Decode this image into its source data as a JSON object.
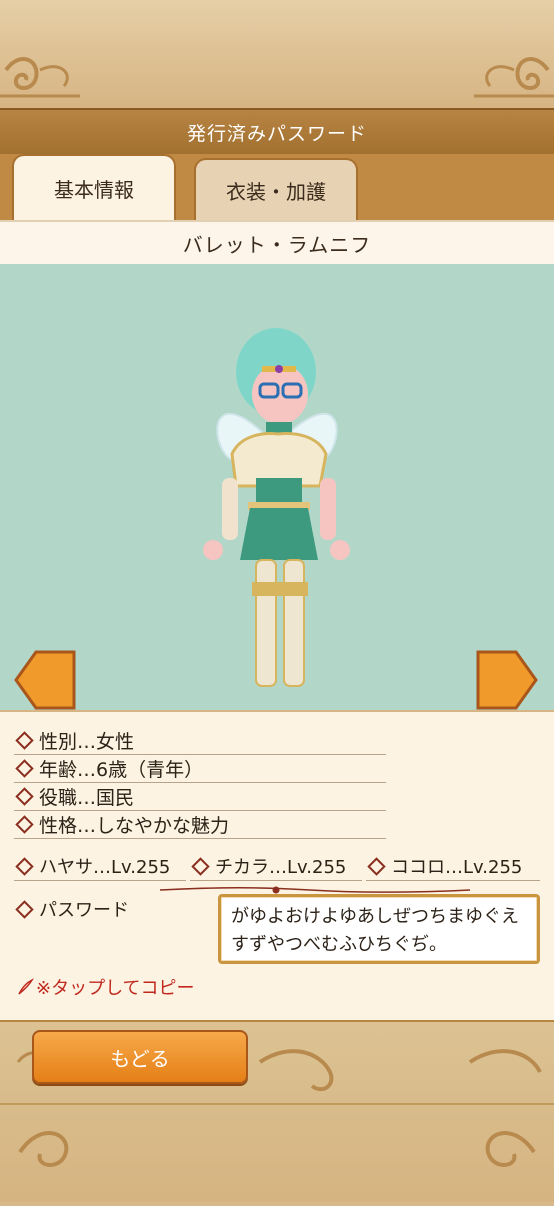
{
  "header": {
    "title": "発行済みパスワード"
  },
  "tabs": [
    {
      "label": "基本情報",
      "active": true
    },
    {
      "label": "衣装・加護",
      "active": false
    }
  ],
  "character": {
    "name": "バレット・ラムニフ",
    "hair_color": "#7fd6c8",
    "dress_color": "#3d9a7f"
  },
  "profile": {
    "gender": "性別…女性",
    "age": "年齢…6歳（青年）",
    "role": "役職…国民",
    "personality": "性格…しなやかな魅力"
  },
  "stats": {
    "speed": "ハヤサ…Lv.255",
    "power": "チカラ…Lv.255",
    "heart": "ココロ…Lv.255"
  },
  "password": {
    "label": "パスワード",
    "value": "がゆよおけよゆあしぜつちまゆぐえすずやつべむふひちぐぢ。"
  },
  "copy_hint": "※タップしてコピー",
  "buttons": {
    "back": "もどる"
  },
  "colors": {
    "viewer_bg": "#b2d7c9",
    "accent_orange": "#e8871c",
    "diamond": "#8a2f1f",
    "copy_red": "#c0281e"
  }
}
